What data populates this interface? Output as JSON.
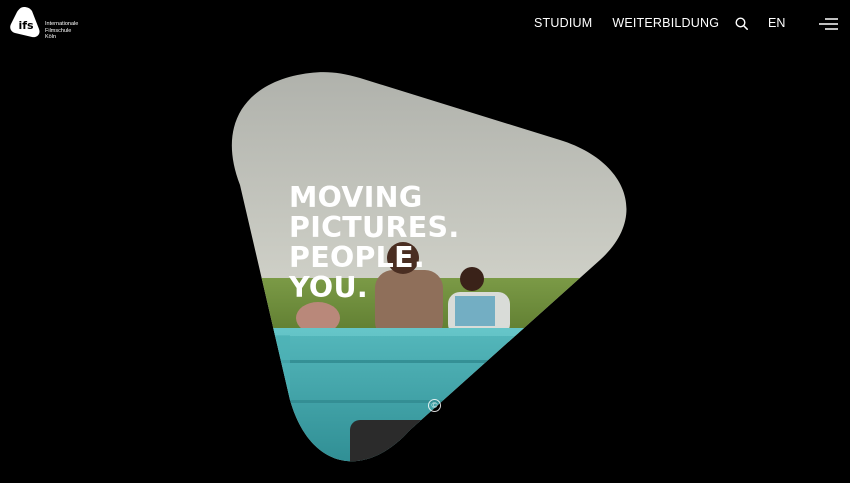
{
  "brand": {
    "mark": "ifs",
    "line1": "Internationale",
    "line2": "Filmschule",
    "line3": "Köln"
  },
  "nav": {
    "items": [
      "STUDIUM",
      "WEITERBILDUNG"
    ],
    "language": "EN"
  },
  "icons": {
    "search": "search-icon",
    "menu": "hamburger-menu-icon",
    "copyright": "copyright-icon"
  },
  "hero": {
    "headline": [
      "MOVING",
      "PICTURES.",
      "PEOPLE.",
      "YOU."
    ],
    "copyright_symbol": "©"
  },
  "colors": {
    "background": "#000000",
    "text": "#ffffff",
    "sky": "#c9cbc0",
    "field": "#6f8a3a",
    "truck": "#3fa3a8"
  }
}
